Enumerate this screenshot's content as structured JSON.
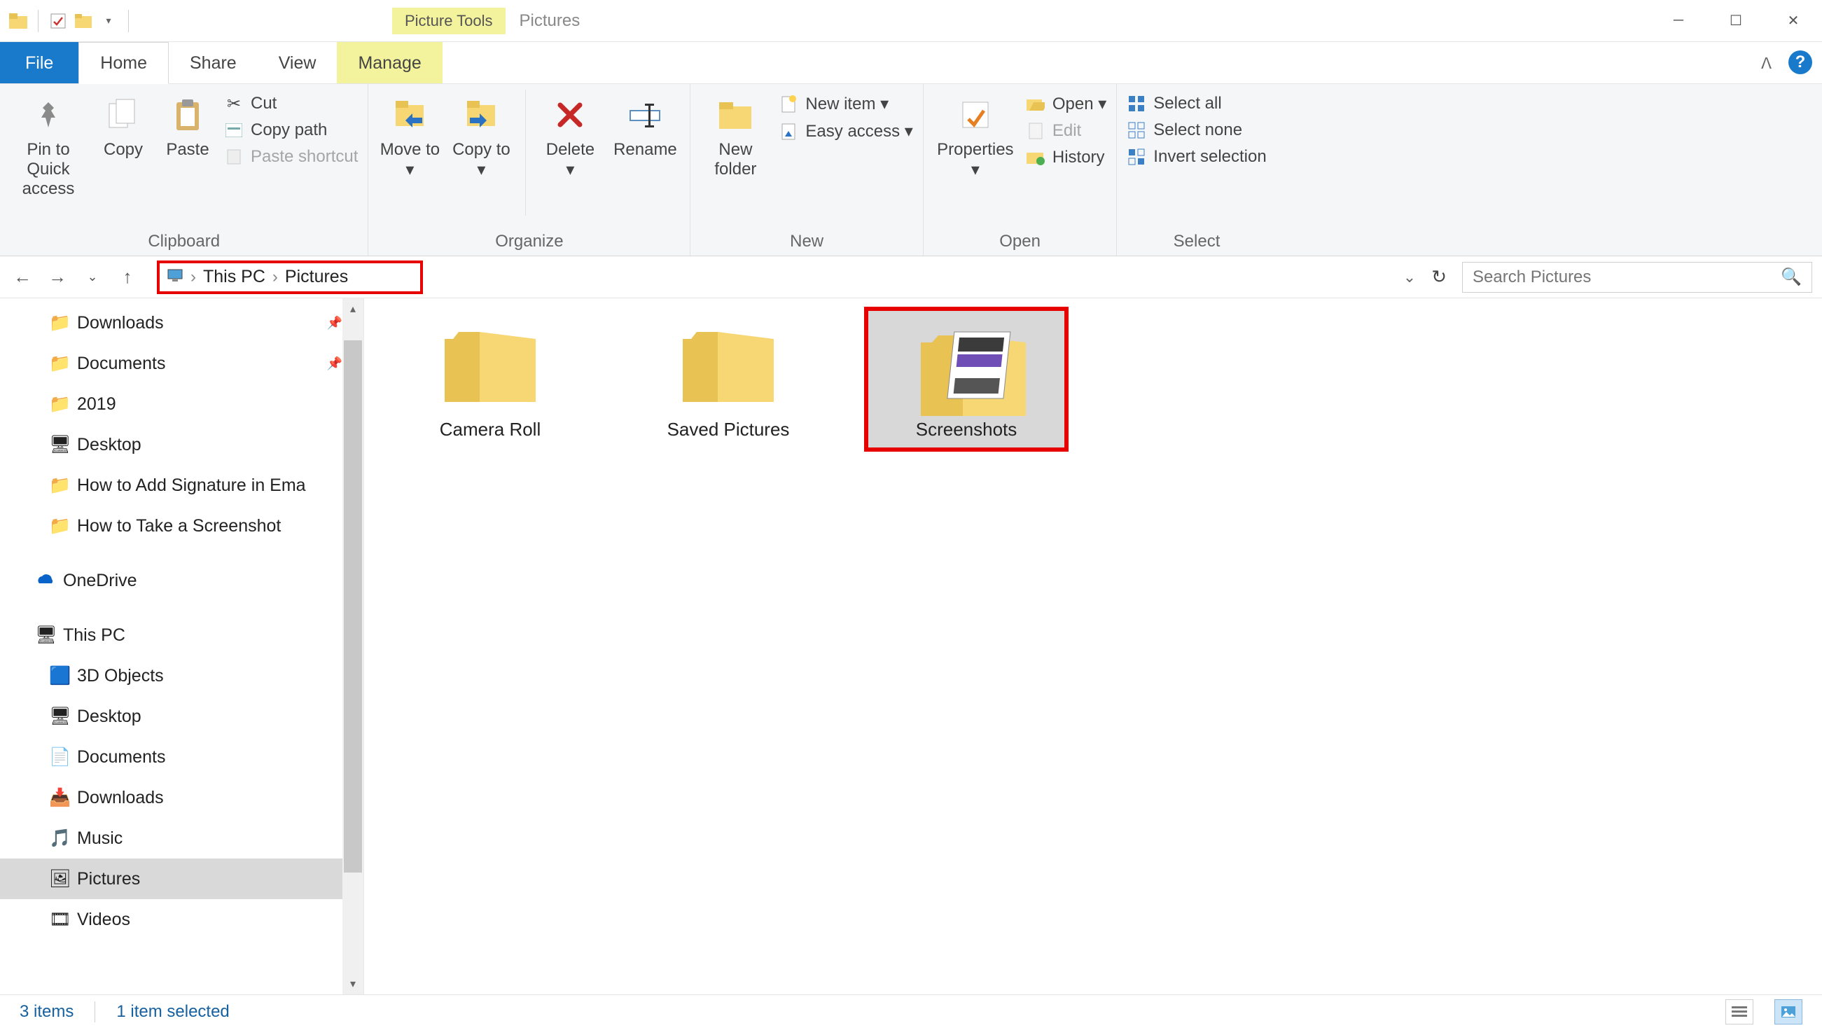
{
  "window": {
    "context_tab": "Picture Tools",
    "title": "Pictures"
  },
  "tabs": {
    "file": "File",
    "home": "Home",
    "share": "Share",
    "view": "View",
    "manage": "Manage"
  },
  "ribbon": {
    "clipboard": {
      "label": "Clipboard",
      "pin": "Pin to Quick access",
      "copy": "Copy",
      "paste": "Paste",
      "cut": "Cut",
      "copy_path": "Copy path",
      "paste_shortcut": "Paste shortcut"
    },
    "organize": {
      "label": "Organize",
      "move_to": "Move to",
      "copy_to": "Copy to",
      "delete": "Delete",
      "rename": "Rename"
    },
    "new": {
      "label": "New",
      "new_folder": "New folder",
      "new_item": "New item",
      "easy_access": "Easy access"
    },
    "open": {
      "label": "Open",
      "properties": "Properties",
      "open": "Open",
      "edit": "Edit",
      "history": "History"
    },
    "select": {
      "label": "Select",
      "select_all": "Select all",
      "select_none": "Select none",
      "invert": "Invert selection"
    }
  },
  "breadcrumb": {
    "root": "This PC",
    "current": "Pictures"
  },
  "search": {
    "placeholder": "Search Pictures"
  },
  "nav": {
    "downloads": "Downloads",
    "documents": "Documents",
    "y2019": "2019",
    "desktop": "Desktop",
    "sig": "How to Add Signature in Ema",
    "screenshot_howto": "How to Take a Screenshot",
    "onedrive": "OneDrive",
    "thispc": "This PC",
    "obj3d": "3D Objects",
    "desktop2": "Desktop",
    "documents2": "Documents",
    "downloads2": "Downloads",
    "music": "Music",
    "pictures": "Pictures",
    "videos": "Videos"
  },
  "items": {
    "camera_roll": "Camera Roll",
    "saved_pictures": "Saved Pictures",
    "screenshots": "Screenshots"
  },
  "status": {
    "count": "3 items",
    "selected": "1 item selected"
  }
}
